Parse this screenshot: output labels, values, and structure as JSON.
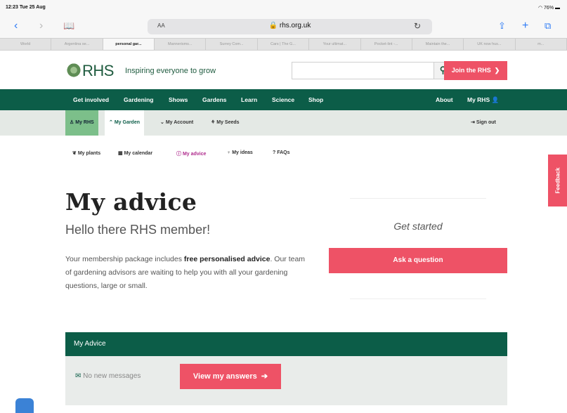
{
  "status": {
    "time": "12:23",
    "date": "Tue 25 Aug",
    "battery": "76%"
  },
  "browser": {
    "aa": "AA",
    "url": "rhs.org.uk"
  },
  "tabs": [
    {
      "label": "World"
    },
    {
      "label": "Argentina se..."
    },
    {
      "label": "personal gar..."
    },
    {
      "label": "Mannerisms..."
    },
    {
      "label": "Surrey Com..."
    },
    {
      "label": "Cars | The G..."
    },
    {
      "label": "Your ultimat..."
    },
    {
      "label": "Pocket-lint -..."
    },
    {
      "label": "Maintain the..."
    },
    {
      "label": "UK now hus..."
    },
    {
      "label": "m..."
    }
  ],
  "header": {
    "logo": "RHS",
    "tagline": "Inspiring everyone to grow",
    "search_placeholder": "",
    "join": "Join the RHS"
  },
  "mainnav": {
    "items": [
      "Get involved",
      "Gardening",
      "Shows",
      "Gardens",
      "Learn",
      "Science",
      "Shop"
    ],
    "about": "About",
    "myrhs": "My RHS"
  },
  "subnav": {
    "items": [
      "My RHS",
      "My Garden",
      "My Account",
      "My Seeds"
    ],
    "signout": "Sign out"
  },
  "thirdnav": {
    "items": [
      "My plants",
      "My calendar",
      "My advice",
      "My ideas",
      "FAQs"
    ]
  },
  "main": {
    "title": "My advice",
    "greeting": "Hello there RHS member!",
    "desc_pre": "Your membership package includes ",
    "desc_bold": "free personalised advice",
    "desc_post": ". Our team of gardening advisors are waiting to help you with all your gardening questions, large or small.",
    "get_started": "Get started",
    "ask_button": "Ask a question"
  },
  "advice_panel": {
    "title": "My Advice",
    "messages": "No new messages",
    "view_button": "View my answers"
  },
  "feedback": "Feedback",
  "colors": {
    "green": "#0c5d48",
    "pink": "#ee5266",
    "lightgreen": "#7cbf8a",
    "magenta": "#b02d8e"
  }
}
